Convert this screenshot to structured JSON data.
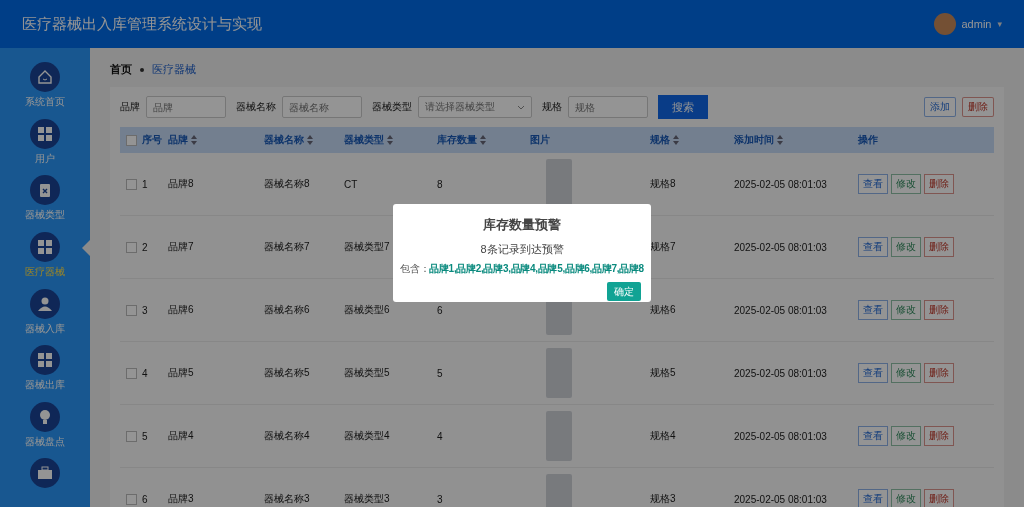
{
  "header": {
    "title": "医疗器械出入库管理系统设计与实现",
    "user": "admin",
    "caret": "▾"
  },
  "sidebar": {
    "items": [
      {
        "label": "系统首页",
        "kind": "home",
        "selected": false
      },
      {
        "label": "用户",
        "kind": "grid",
        "selected": false
      },
      {
        "label": "器械类型",
        "kind": "clipboard",
        "selected": false
      },
      {
        "label": "医疗器械",
        "kind": "grid",
        "selected": true
      },
      {
        "label": "器械入库",
        "kind": "person",
        "selected": false
      },
      {
        "label": "器械出库",
        "kind": "grid",
        "selected": false
      },
      {
        "label": "器械盘点",
        "kind": "bulb",
        "selected": false
      },
      {
        "kind": "briefcase",
        "selected": false
      }
    ]
  },
  "breadcrumb": [
    {
      "label": "首页",
      "selected": false
    },
    {
      "label": "医疗器械",
      "selected": true
    }
  ],
  "filters": [
    {
      "kind": "input",
      "label": "品牌",
      "placeholder": "品牌"
    },
    {
      "kind": "input",
      "label": "器械名称",
      "placeholder": "器械名称"
    },
    {
      "kind": "select",
      "label": "器械类型",
      "placeholder": "请选择器械类型"
    },
    {
      "kind": "input",
      "label": "规格",
      "placeholder": "规格"
    }
  ],
  "search_button": "搜索",
  "actions": [
    {
      "label": "添加",
      "kind": "add"
    },
    {
      "label": "删除",
      "kind": "delete"
    }
  ],
  "table": {
    "all_checked": false,
    "columns": [
      {
        "label": "序号",
        "sortable": false
      },
      {
        "label": "品牌",
        "sortable": true
      },
      {
        "label": "器械名称",
        "sortable": true
      },
      {
        "label": "器械类型",
        "sortable": true
      },
      {
        "label": "库存数量",
        "sortable": true
      },
      {
        "label": "图片",
        "sortable": false
      },
      {
        "label": "规格",
        "sortable": true
      },
      {
        "label": "添加时间",
        "sortable": true
      },
      {
        "label": "操作",
        "sortable": false
      }
    ],
    "rows": [
      {
        "checked": false,
        "index": "1",
        "brand": "品牌8",
        "name": "器械名称8",
        "type": "CT",
        "quantity": "8",
        "spec": "规格8",
        "time": "2025-02-05 08:01:03",
        "actions": [
          {
            "label": "查看",
            "kind": "view"
          },
          {
            "label": "修改",
            "kind": "edit"
          },
          {
            "label": "删除",
            "kind": "delete"
          }
        ]
      },
      {
        "checked": false,
        "index": "2",
        "brand": "品牌7",
        "name": "器械名称7",
        "type": "器械类型7",
        "spec": "规格7",
        "time": "2025-02-05 08:01:03",
        "actions": [
          {
            "label": "查看",
            "kind": "view"
          },
          {
            "label": "修改",
            "kind": "edit"
          },
          {
            "label": "删除",
            "kind": "delete"
          }
        ]
      },
      {
        "checked": false,
        "index": "3",
        "brand": "品牌6",
        "name": "器械名称6",
        "type": "器械类型6",
        "quantity": "6",
        "spec": "规格6",
        "time": "2025-02-05 08:01:03",
        "actions": [
          {
            "label": "查看",
            "kind": "view"
          },
          {
            "label": "修改",
            "kind": "edit"
          },
          {
            "label": "删除",
            "kind": "delete"
          }
        ]
      },
      {
        "checked": false,
        "index": "4",
        "brand": "品牌5",
        "name": "器械名称5",
        "type": "器械类型5",
        "quantity": "5",
        "spec": "规格5",
        "time": "2025-02-05 08:01:03",
        "actions": [
          {
            "label": "查看",
            "kind": "view"
          },
          {
            "label": "修改",
            "kind": "edit"
          },
          {
            "label": "删除",
            "kind": "delete"
          }
        ]
      },
      {
        "checked": false,
        "index": "5",
        "brand": "品牌4",
        "name": "器械名称4",
        "type": "器械类型4",
        "quantity": "4",
        "spec": "规格4",
        "time": "2025-02-05 08:01:03",
        "actions": [
          {
            "label": "查看",
            "kind": "view"
          },
          {
            "label": "修改",
            "kind": "edit"
          },
          {
            "label": "删除",
            "kind": "delete"
          }
        ]
      },
      {
        "checked": false,
        "index": "6",
        "brand": "品牌3",
        "name": "器械名称3",
        "type": "器械类型3",
        "quantity": "3",
        "spec": "规格3",
        "time": "2025-02-05 08:01:03",
        "actions": [
          {
            "label": "查看",
            "kind": "view"
          },
          {
            "label": "修改",
            "kind": "edit"
          },
          {
            "label": "删除",
            "kind": "delete"
          }
        ]
      }
    ]
  },
  "dialog": {
    "title": "库存数量预警",
    "message": "8条记录到达预警",
    "contains_label": "包含：",
    "contains": "品牌1,品牌2,品牌3,品牌4,品牌5,品牌6,品牌7,品牌8",
    "button": "确定"
  }
}
